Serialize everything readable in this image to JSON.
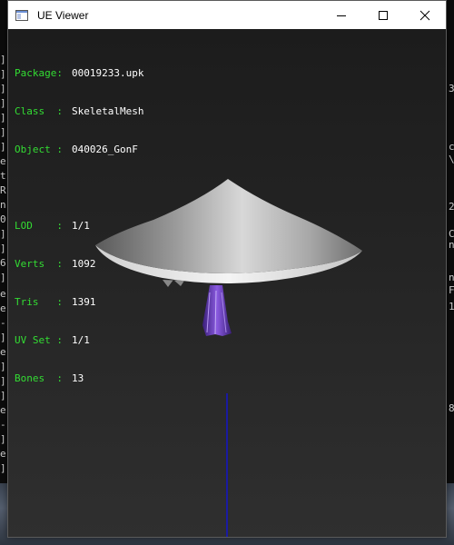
{
  "window": {
    "title": "UE Viewer"
  },
  "info_panel": {
    "package": {
      "label": "Package:",
      "value": "00019233.upk"
    },
    "class": {
      "label": "Class  :",
      "value": "SkeletalMesh"
    },
    "object": {
      "label": "Object :",
      "value": "040026_GonF"
    },
    "lod": {
      "label": "LOD    :",
      "value": "1/1"
    },
    "verts": {
      "label": "Verts  :",
      "value": "1092"
    },
    "tris": {
      "label": "Tris   :",
      "value": "1391"
    },
    "uvset": {
      "label": "UV Set :",
      "value": "1/1"
    },
    "bones": {
      "label": "Bones  :",
      "value": "13"
    }
  },
  "colors": {
    "label_green": "#33dd33",
    "value_white": "#ffffff",
    "axis_blue": "#1515c8",
    "tassel_purple": "#6a3cc0"
  },
  "icons": {
    "app": "app-window-icon",
    "minimize": "minimize-icon",
    "maximize": "maximize-icon",
    "close": "close-icon"
  }
}
